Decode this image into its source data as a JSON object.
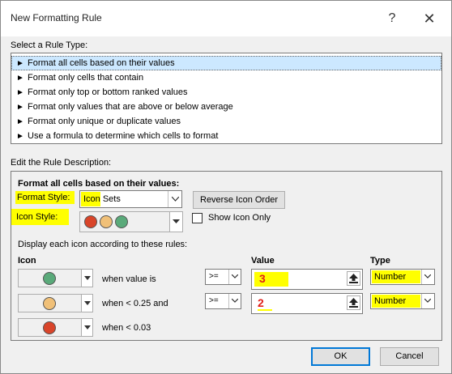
{
  "window": {
    "title": "New Formatting Rule",
    "help_glyph": "?",
    "close_glyph": "✕"
  },
  "rule_type": {
    "label": "Select a Rule Type:",
    "items": [
      {
        "label": "Format all cells based on their values",
        "selected": true
      },
      {
        "label": "Format only cells that contain",
        "selected": false
      },
      {
        "label": "Format only top or bottom ranked values",
        "selected": false
      },
      {
        "label": "Format only values that are above or below average",
        "selected": false
      },
      {
        "label": "Format only unique or duplicate values",
        "selected": false
      },
      {
        "label": "Use a formula to determine which cells to format",
        "selected": false
      }
    ],
    "bullet": "►"
  },
  "description": {
    "label": "Edit the Rule Description:",
    "heading": "Format all cells based on their values:",
    "format_style_label": "Format Style:",
    "format_style_value": "Icon Sets",
    "reverse_button": "Reverse Icon Order",
    "icon_style_label": "Icon Style:",
    "show_icon_only_label": "Show Icon Only",
    "show_icon_only_checked": false,
    "display_rule_text": "Display each icon according to these rules:",
    "col_icon": "Icon",
    "col_value": "Value",
    "col_type": "Type",
    "rows": [
      {
        "icon": "green-circle-icon",
        "color": "#5aaa7a",
        "condition": "when value is",
        "operator": ">=",
        "value": "3",
        "type": "Number"
      },
      {
        "icon": "yellow-circle-icon",
        "color": "#f0c078",
        "condition": "when < 0.25 and",
        "operator": ">=",
        "value": "2",
        "type": "Number"
      },
      {
        "icon": "red-circle-icon",
        "color": "#d9452a",
        "condition": "when < 0.03"
      }
    ]
  },
  "icon_style_colors": [
    "#d9452a",
    "#f0c078",
    "#5aaa7a"
  ],
  "footer": {
    "ok": "OK",
    "cancel": "Cancel"
  },
  "colors": {
    "highlight": "#ffff00",
    "selection": "#cce8ff",
    "annotation_red": "#e0201a"
  }
}
